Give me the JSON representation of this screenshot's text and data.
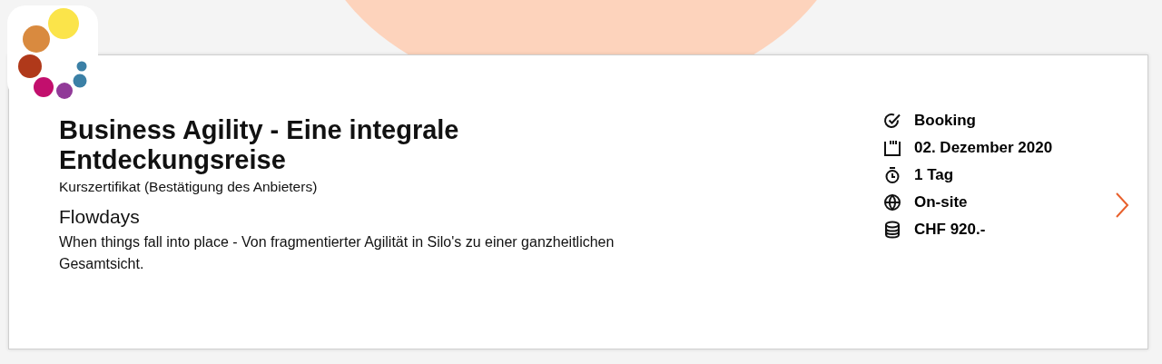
{
  "course": {
    "title": "Business Agility - Eine integrale Entdeckungsreise",
    "certificate": "Kurszertifikat (Bestätigung des Anbieters)",
    "provider": "Flowdays",
    "description": "When things fall into place - Von fragmentierter Agilität in Silo's zu einer ganzheitlichen Gesamtsicht.",
    "details": [
      {
        "kind": "status",
        "text": "Booking"
      },
      {
        "kind": "date",
        "text": "02. Dezember 2020"
      },
      {
        "kind": "duration",
        "text": "1 Tag"
      },
      {
        "kind": "location",
        "text": "On-site"
      },
      {
        "kind": "price",
        "text": "CHF 920.-"
      }
    ]
  }
}
